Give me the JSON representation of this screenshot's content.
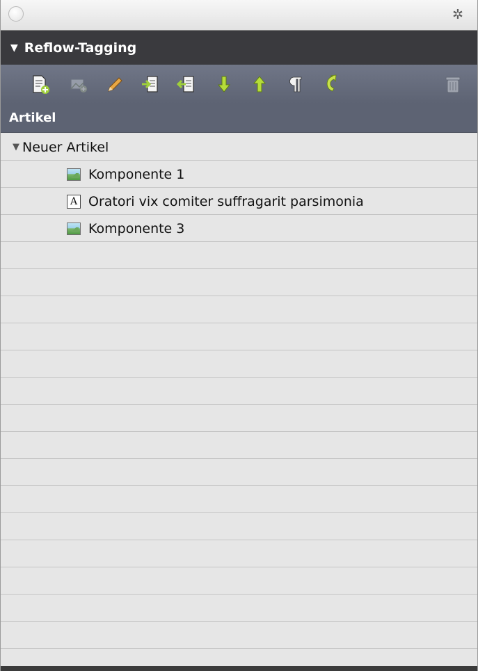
{
  "window": {
    "close_icon": "close-dot-icon",
    "menu_icon": "gear-icon"
  },
  "panel": {
    "title": "Reflow-Tagging",
    "column_header": "Artikel"
  },
  "toolbar": {
    "buttons": [
      {
        "icon": "new-article-icon"
      },
      {
        "icon": "new-component-icon",
        "state": "disabled"
      },
      {
        "icon": "edit-pencil-icon"
      },
      {
        "icon": "add-to-article-icon"
      },
      {
        "icon": "remove-from-article-icon"
      },
      {
        "icon": "move-down-icon"
      },
      {
        "icon": "move-up-icon"
      },
      {
        "icon": "paragraph-icon"
      },
      {
        "icon": "undo-arrow-icon"
      },
      {
        "icon": "trash-icon",
        "state": "disabled"
      }
    ]
  },
  "tree": {
    "article": "Neuer Artikel",
    "components": [
      {
        "label": "Komponente 1",
        "type": "image"
      },
      {
        "label": "Oratori vix comiter suffragarit parsimonia",
        "type": "text"
      },
      {
        "label": "Komponente 3",
        "type": "image"
      }
    ]
  },
  "colors": {
    "header_dark": "#3a3a3e",
    "toolbar": "#5d6373",
    "accent_green": "#c8e04c",
    "list_bg": "#e6e6e6"
  }
}
